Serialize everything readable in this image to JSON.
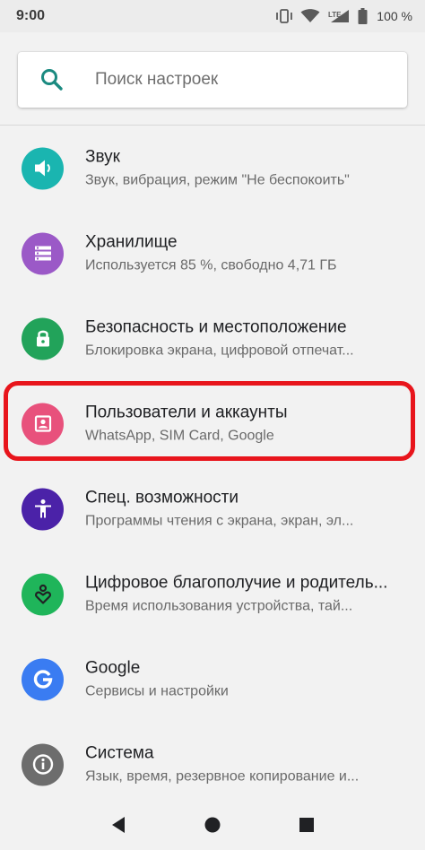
{
  "status_bar": {
    "time": "9:00",
    "battery_text": "100 %",
    "icons": [
      "vibrate-icon",
      "wifi-icon",
      "signal-lte-icon",
      "battery-icon"
    ]
  },
  "search": {
    "placeholder": "Поиск настроек",
    "icon": "search-icon"
  },
  "settings": {
    "items": [
      {
        "title": "Звук",
        "subtitle": "Звук, вибрация, режим \"Не беспокоить\"",
        "icon": "volume-icon",
        "color": "#1ab5b0"
      },
      {
        "title": "Хранилище",
        "subtitle": "Используется 85 %, свободно 4,71 ГБ",
        "icon": "storage-icon",
        "color": "#9b59c7"
      },
      {
        "title": "Безопасность и местоположение",
        "subtitle": "Блокировка экрана, цифровой отпечат...",
        "icon": "lock-icon",
        "color": "#22a35a"
      },
      {
        "title": "Пользователи и аккаунты",
        "subtitle": "WhatsApp, SIM Card, Google",
        "icon": "account-icon",
        "color": "#e8517c"
      },
      {
        "title": "Спец. возможности",
        "subtitle": "Программы чтения с экрана, экран, эл...",
        "icon": "accessibility-icon",
        "color": "#4b22a8"
      },
      {
        "title": "Цифровое благополучие и родитель...",
        "subtitle": "Время использования устройства, тай...",
        "icon": "wellbeing-icon",
        "color": "#1fb55a"
      },
      {
        "title": "Google",
        "subtitle": "Сервисы и настройки",
        "icon": "google-icon",
        "color": "#3a7cf2"
      },
      {
        "title": "Система",
        "subtitle": "Язык, время, резервное копирование и...",
        "icon": "info-icon",
        "color": "#6d6d6d"
      }
    ]
  },
  "highlight": {
    "target": "Пользователи и аккаунты",
    "color": "#e8151c"
  },
  "nav_bar": {
    "buttons": [
      "back-icon",
      "home-icon",
      "recents-icon"
    ]
  }
}
